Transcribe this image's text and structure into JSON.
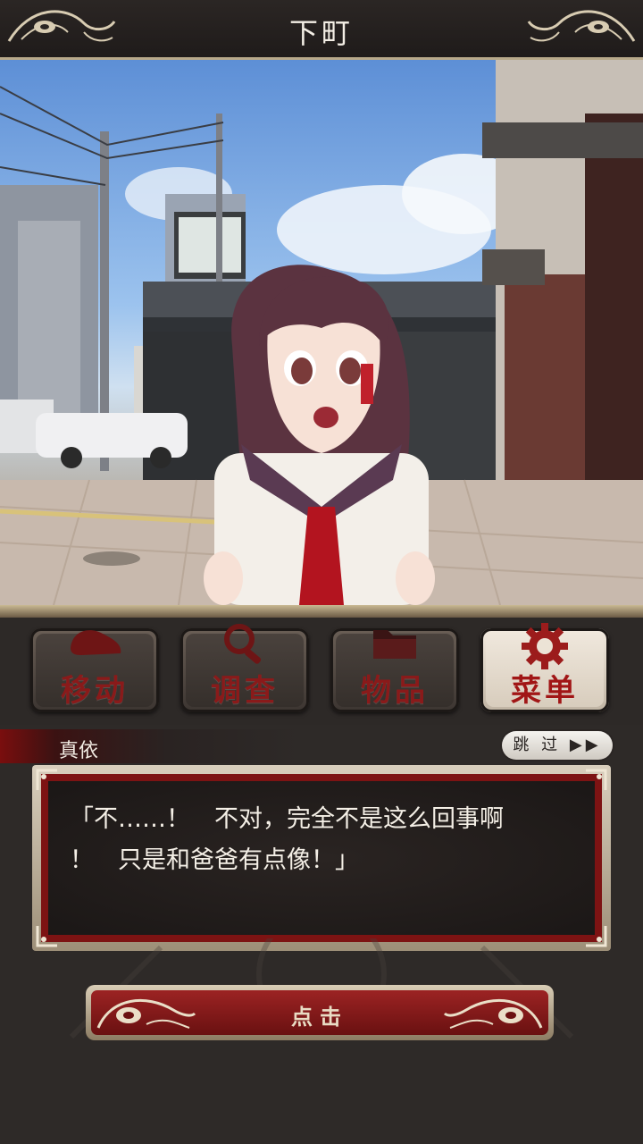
{
  "title_bar": {
    "title": "下町"
  },
  "commands": [
    {
      "label": "移动",
      "icon": "footprint-icon"
    },
    {
      "label": "调查",
      "icon": "magnifier-icon"
    },
    {
      "label": "物品",
      "icon": "folder-icon"
    },
    {
      "label": "菜单",
      "icon": "gear-icon"
    }
  ],
  "dialogue": {
    "speaker": "真依",
    "skip_label": "跳 过",
    "line1": "「不……！　不对，完全不是这么回事啊",
    "line2": "！　只是和爸爸有点像！」"
  },
  "tap_button": {
    "label": "点击"
  },
  "colors": {
    "accent_red": "#8a1a1a",
    "frame_gold": "#c9b993",
    "panel_dark": "#2d2927"
  }
}
